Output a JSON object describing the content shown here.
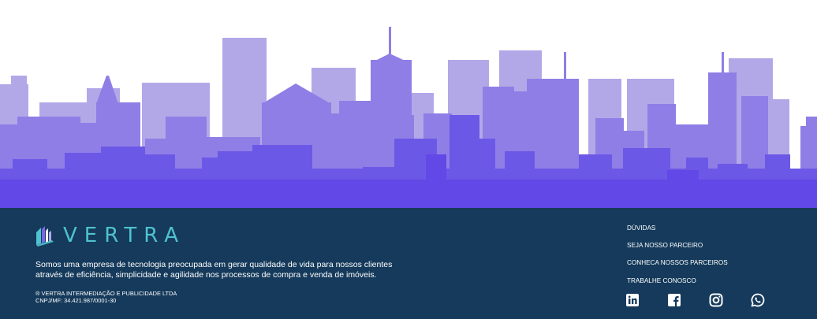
{
  "brand": {
    "name": "VERTRA",
    "accent_color": "#4fc2cf",
    "mark_icon": "building-bars-icon"
  },
  "colors": {
    "footer_bg": "#153a5b",
    "skyline_back": "#b2a8e8",
    "skyline_mid": "#8f7ee6",
    "skyline_front": "#6c58e6"
  },
  "footer": {
    "about": {
      "line1": "Somos uma empresa de tecnologia preocupada em gerar qualidade de vida para nossos clientes",
      "line2": "através de eficiência, simplicidade e agilidade nos processos de compra e venda de imóveis."
    },
    "legal": {
      "company": "® VERTRA INTERMEDIAÇÃO E PUBLICIDADE LTDA",
      "cnpj": "CNPJ/MF: 34.421.987/0001-30"
    },
    "links": [
      {
        "label": "DÚVIDAS"
      },
      {
        "label": "SEJA NOSSO PARCEIRO"
      },
      {
        "label": "CONHECA NOSSOS PARCEIROS"
      },
      {
        "label": "TRABALHE CONOSCO"
      }
    ],
    "social": [
      {
        "icon": "linkedin-icon"
      },
      {
        "icon": "facebook-icon"
      },
      {
        "icon": "instagram-icon"
      },
      {
        "icon": "whatsapp-icon"
      }
    ]
  }
}
